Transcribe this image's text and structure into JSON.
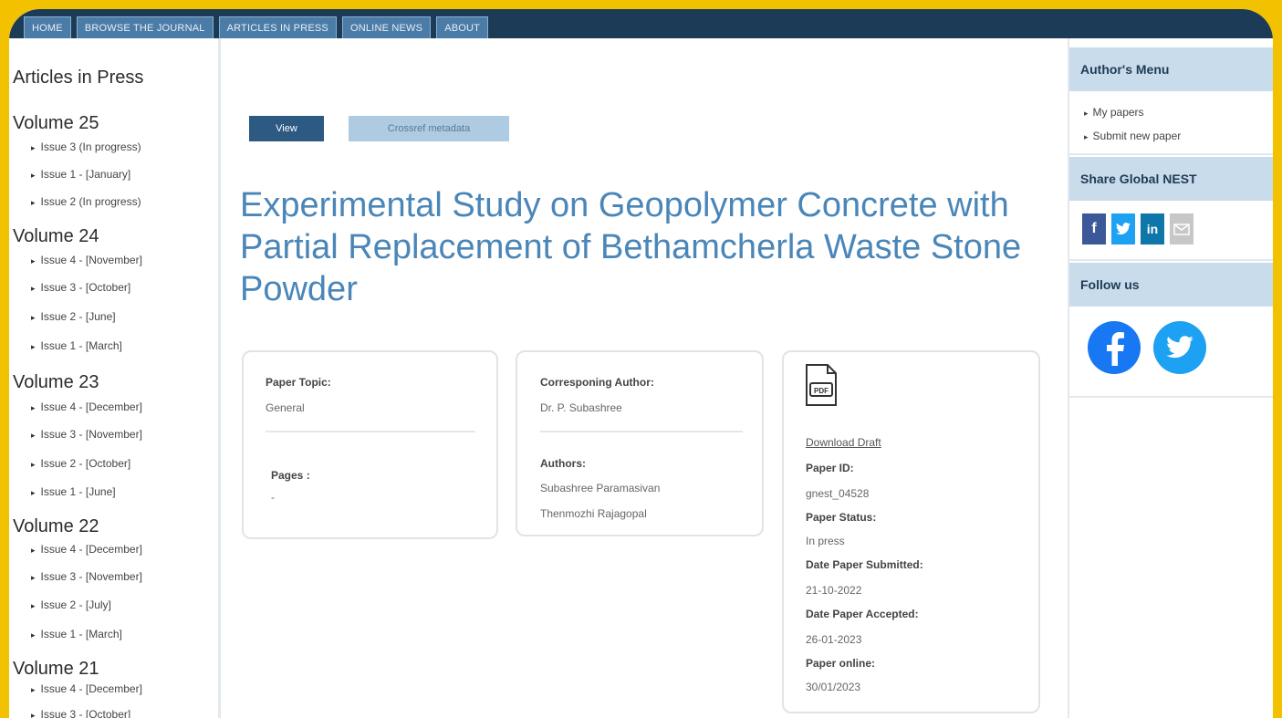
{
  "nav": [
    "HOME",
    "BROWSE THE JOURNAL",
    "ARTICLES IN PRESS",
    "ONLINE NEWS",
    "ABOUT"
  ],
  "left": {
    "heading": "Articles in Press",
    "volumes": [
      {
        "label": "Volume 25",
        "issues": [
          "Issue 3 (In progress)",
          "Issue 1 - [January]",
          "Issue 2 (In progress)"
        ]
      },
      {
        "label": "Volume 24",
        "issues": [
          "Issue 4 - [November]",
          "Issue 3 - [October]",
          "Issue 2 - [June]",
          "Issue 1 - [March]"
        ]
      },
      {
        "label": "Volume 23",
        "issues": [
          "Issue 4 - [December]",
          "Issue 3 - [November]",
          "Issue 2 - [October]",
          "Issue 1 - [June]"
        ]
      },
      {
        "label": "Volume 22",
        "issues": [
          "Issue 4 - [December]",
          "Issue 3 - [November]",
          "Issue 2 - [July]",
          "Issue 1 - [March]"
        ]
      },
      {
        "label": "Volume 21",
        "issues": [
          "Issue 4 - [December]",
          "Issue 3 - [October]"
        ]
      }
    ]
  },
  "main": {
    "view_label": "View",
    "crossref_label": "Crossref metadata",
    "title": "Experimental Study on Geopolymer Concrete with Partial Replacement of Bethamcherla Waste Stone Powder",
    "topic_label": "Paper Topic:",
    "topic_value": "General",
    "pages_label": "Pages :",
    "pages_value": "-",
    "corr_label": "Corresponing Author:",
    "corr_value": "Dr. P. Subashree",
    "authors_label": "Authors:",
    "authors": [
      "Subashree Paramasivan",
      "Thenmozhi Rajagopal"
    ],
    "pdf_text": "PDF",
    "download_label": "Download Draft",
    "paper_id_label": "Paper ID:",
    "paper_id_value": "gnest_04528",
    "status_label": "Paper Status:",
    "status_value": "In press",
    "submitted_label": "Date Paper Submitted:",
    "submitted_value": "21-10-2022",
    "accepted_label": "Date Paper Accepted:",
    "accepted_value": "26-01-2023",
    "online_label": "Paper online:",
    "online_value": "30/01/2023"
  },
  "right": {
    "author_menu": "Author's Menu",
    "author_items": [
      "My papers",
      "Submit new paper"
    ],
    "share_heading": "Share Global NEST",
    "share_icons": [
      "facebook-icon",
      "twitter-icon",
      "linkedin-icon",
      "email-icon"
    ],
    "follow_heading": "Follow us",
    "colors": {
      "facebook": "#3b5998",
      "twitter": "#1da1f2",
      "linkedin": "#0e76a8",
      "email": "#c7c7c7"
    }
  }
}
